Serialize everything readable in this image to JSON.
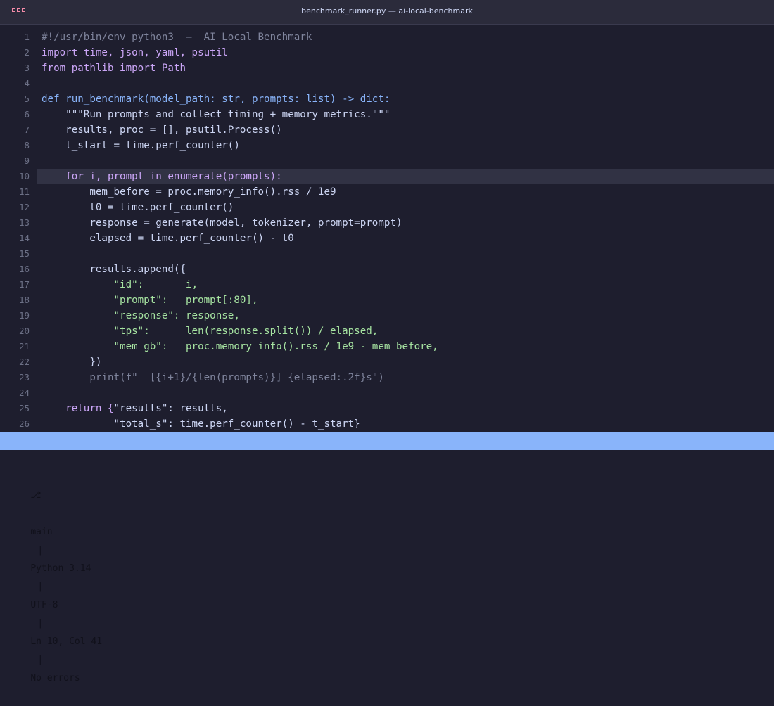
{
  "window": {
    "title": "benchmark_runner.py — ai-local-benchmark"
  },
  "editor": {
    "current_line": 10,
    "lines": [
      {
        "n": "1",
        "tokens": [
          {
            "t": "#!/usr/bin/env python3  —  AI Local Benchmark",
            "c": "comment"
          }
        ]
      },
      {
        "n": "2",
        "tokens": [
          {
            "t": "import",
            "c": "kw"
          },
          {
            "t": " time, json, yaml, psutil",
            "c": "kw"
          }
        ]
      },
      {
        "n": "3",
        "tokens": [
          {
            "t": "from pathlib import Path",
            "c": "kw"
          }
        ]
      },
      {
        "n": "4",
        "tokens": []
      },
      {
        "n": "5",
        "tokens": [
          {
            "t": "def run_benchmark(model_path: str, prompts: list) -> dict:",
            "c": "fn"
          }
        ]
      },
      {
        "n": "6",
        "tokens": [
          {
            "t": "    \"\"\"Run prompts and collect timing + memory metrics.\"\"\"",
            "c": "plain"
          }
        ]
      },
      {
        "n": "7",
        "tokens": [
          {
            "t": "    results, proc = [], psutil.Process()",
            "c": "plain"
          }
        ]
      },
      {
        "n": "8",
        "tokens": [
          {
            "t": "    t_start = time.perf_counter()",
            "c": "plain"
          }
        ]
      },
      {
        "n": "9",
        "tokens": []
      },
      {
        "n": "10",
        "tokens": [
          {
            "t": "    for i, prompt in enumerate(prompts):",
            "c": "kw"
          }
        ]
      },
      {
        "n": "11",
        "tokens": [
          {
            "t": "        mem_before = proc.memory_info().rss / 1e9",
            "c": "plain"
          }
        ]
      },
      {
        "n": "12",
        "tokens": [
          {
            "t": "        t0 = time.perf_counter()",
            "c": "plain"
          }
        ]
      },
      {
        "n": "13",
        "tokens": [
          {
            "t": "        response = generate(model, tokenizer, prompt=prompt)",
            "c": "plain"
          }
        ]
      },
      {
        "n": "14",
        "tokens": [
          {
            "t": "        elapsed = time.perf_counter() - t0",
            "c": "plain"
          }
        ]
      },
      {
        "n": "15",
        "tokens": []
      },
      {
        "n": "16",
        "tokens": [
          {
            "t": "        results.append({",
            "c": "plain"
          }
        ]
      },
      {
        "n": "17",
        "tokens": [
          {
            "t": "            \"id\":       i,",
            "c": "str"
          }
        ]
      },
      {
        "n": "18",
        "tokens": [
          {
            "t": "            \"prompt\":   prompt[:80],",
            "c": "str"
          }
        ]
      },
      {
        "n": "19",
        "tokens": [
          {
            "t": "            \"response\": response,",
            "c": "str"
          }
        ]
      },
      {
        "n": "20",
        "tokens": [
          {
            "t": "            \"tps\":      len(response.split()) / elapsed,",
            "c": "str"
          }
        ]
      },
      {
        "n": "21",
        "tokens": [
          {
            "t": "            \"mem_gb\":   proc.memory_info().rss / 1e9 - mem_before,",
            "c": "str"
          }
        ]
      },
      {
        "n": "22",
        "tokens": [
          {
            "t": "        })",
            "c": "plain"
          }
        ]
      },
      {
        "n": "23",
        "tokens": [
          {
            "t": "        print(f\"  [{i+1}/{len(prompts)}] {elapsed:.2f}s\")",
            "c": "comment"
          }
        ]
      },
      {
        "n": "24",
        "tokens": []
      },
      {
        "n": "25",
        "tokens": [
          {
            "t": "    return {",
            "c": "kw"
          },
          {
            "t": "\"results\": results,",
            "c": "plain"
          }
        ]
      },
      {
        "n": "26",
        "tokens": [
          {
            "t": "            \"total_s\": time.perf_counter() - t_start}",
            "c": "plain"
          }
        ]
      }
    ]
  },
  "statusbar": {
    "branch_icon": "git-branch-icon",
    "branch_glyph": "⎇",
    "branch": "main",
    "language": "Python 3.14",
    "encoding": "UTF-8",
    "cursor": "Ln 10, Col 41",
    "diagnostics": "No errors",
    "separator": "|"
  },
  "colors": {
    "background": "#1e1e2e",
    "statusbar": "#89b4fa",
    "current_line": "#313244"
  }
}
